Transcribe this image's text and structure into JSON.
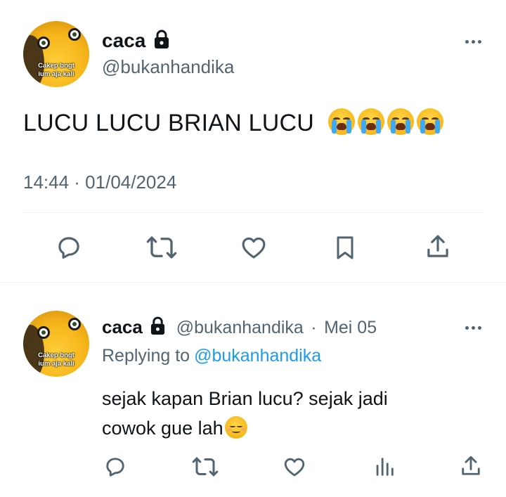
{
  "main_tweet": {
    "display_name": "caca",
    "handle": "@bukanhandika",
    "avatar_caption_line1": "Cakep bngt",
    "avatar_caption_line2": "ium aja kali",
    "text": "LUCU LUCU BRIAN LUCU",
    "emoji": "loudly-crying-face",
    "emoji_count": 4,
    "timestamp": "14:44 · 01/04/2024",
    "actions": [
      "reply",
      "retweet",
      "like",
      "bookmark",
      "share"
    ]
  },
  "reply_tweet": {
    "display_name": "caca",
    "handle": "@bukanhandika",
    "separator": "·",
    "date": "Mei 05",
    "replying_prefix": "Replying to",
    "replying_to": "@bukanhandika",
    "text_line1": "sejak kapan Brian lucu? sejak jadi",
    "text_line2": "cowok gue lah",
    "emoji": "relieved-face",
    "actions": [
      "reply",
      "retweet",
      "like",
      "views",
      "share"
    ]
  },
  "colors": {
    "text": "#0f1419",
    "secondary": "#536471",
    "link": "#1d9bf0",
    "divider": "#eff3f4"
  }
}
